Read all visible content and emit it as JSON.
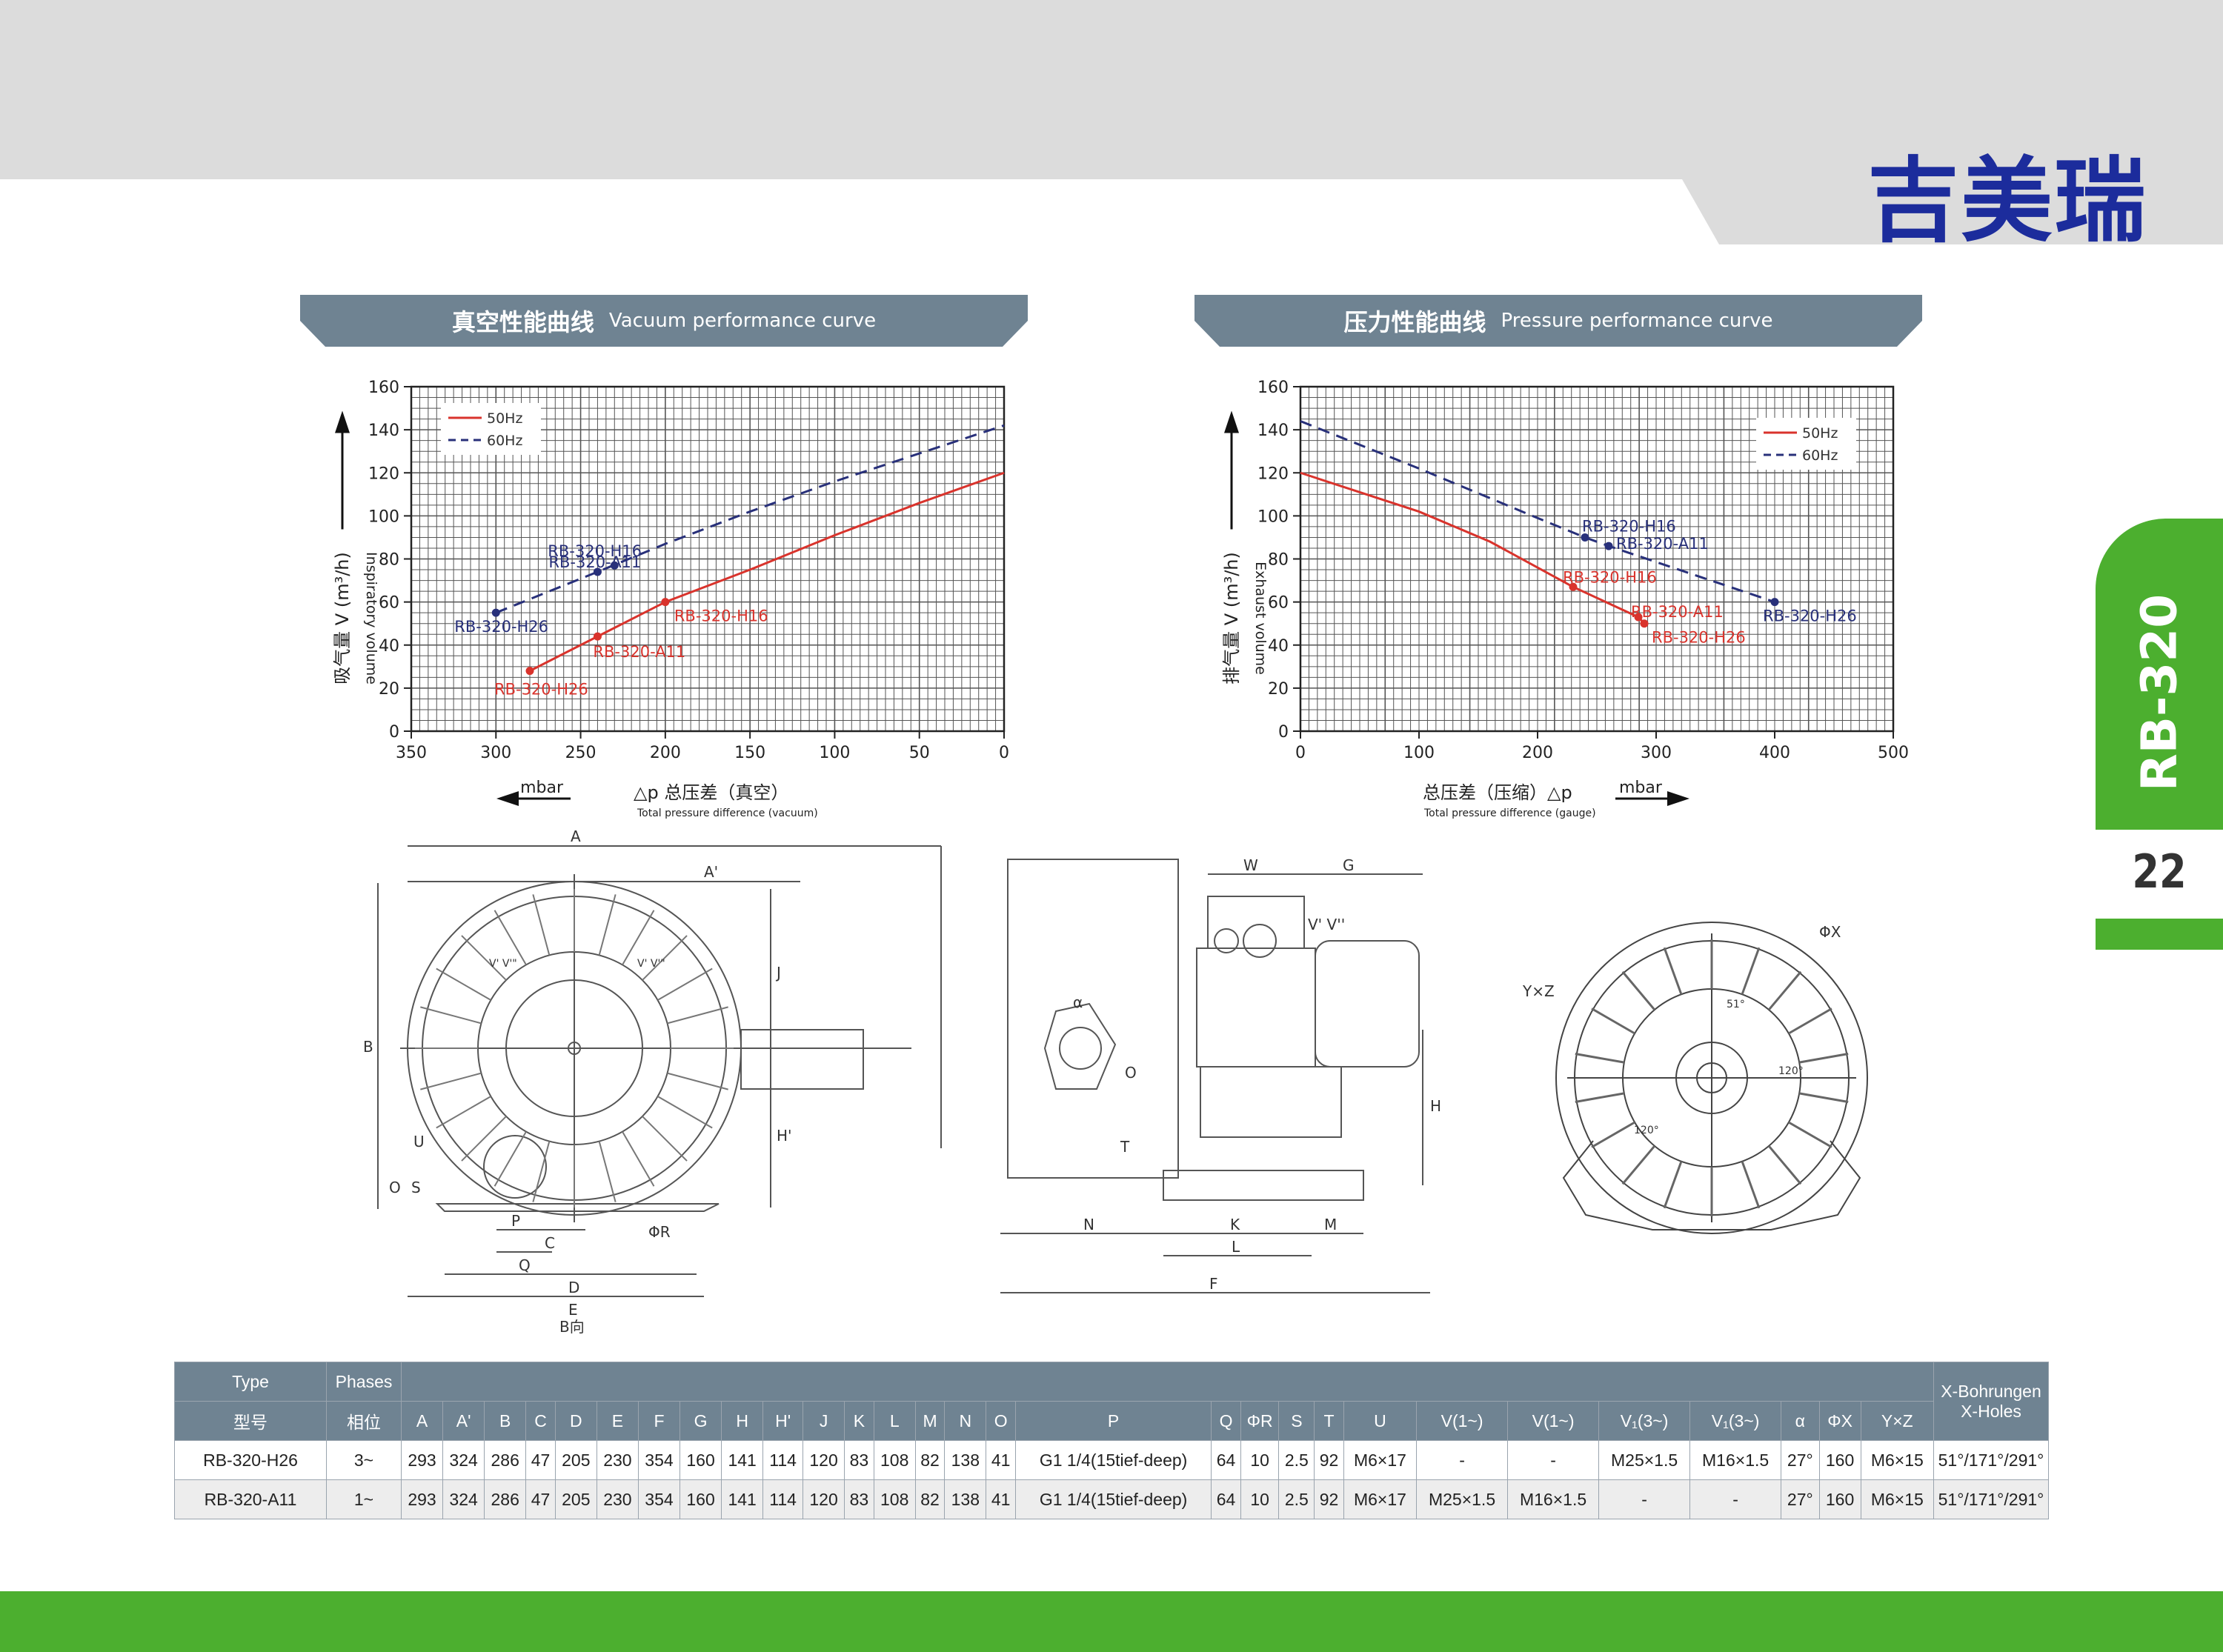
{
  "header": {
    "brand": "吉美瑞"
  },
  "side": {
    "model": "RB-320",
    "page": "22"
  },
  "vacuum": {
    "title_zh": "真空性能曲线",
    "title_en": "Vacuum performance curve",
    "ylabel_zh": "吸气量 V (m³/h)",
    "ylabel_en": "Inspiratory volume",
    "xlabel_unit": "mbar",
    "xlabel_zh": "△p  总压差（真空）",
    "xlabel_en": "Total pressure difference (vacuum)"
  },
  "pressure": {
    "title_zh": "压力性能曲线",
    "title_en": "Pressure performance curve",
    "ylabel_zh": "排气量 V (m³/h)",
    "ylabel_en": "Exhaust volume",
    "xlabel_unit": "mbar",
    "xlabel_zh": "总压差（压缩）△p",
    "xlabel_en": "Total pressure difference (gauge)"
  },
  "chart_data": [
    {
      "type": "line",
      "title": "真空性能曲线 Vacuum performance curve",
      "xlabel": "△p 总压差（真空） Total pressure difference (vacuum) mbar",
      "ylabel": "吸气量 V (m³/h) Inspiratory volume",
      "xlim": [
        350,
        0
      ],
      "ylim": [
        0,
        160
      ],
      "xticks": [
        350,
        300,
        250,
        200,
        150,
        100,
        50,
        0
      ],
      "yticks": [
        0,
        20,
        40,
        60,
        80,
        100,
        120,
        140,
        160
      ],
      "grid": true,
      "legend": "top-left",
      "series": [
        {
          "name": "50Hz",
          "color": "#d9332c",
          "dash": false,
          "x": [
            280,
            240,
            200,
            150,
            100,
            50,
            0
          ],
          "y": [
            28,
            44,
            60,
            75,
            91,
            106,
            120
          ]
        },
        {
          "name": "60Hz",
          "color": "#28307a",
          "dash": true,
          "x": [
            300,
            240,
            200,
            150,
            100,
            50,
            0
          ],
          "y": [
            55,
            74,
            87,
            102,
            116,
            129,
            142
          ]
        }
      ],
      "points": [
        {
          "label": "RB-320-H26",
          "x": 280,
          "y": 28,
          "series": "50Hz"
        },
        {
          "label": "RB-320-A11",
          "x": 240,
          "y": 44,
          "series": "50Hz"
        },
        {
          "label": "RB-320-H16",
          "x": 200,
          "y": 60,
          "series": "50Hz"
        },
        {
          "label": "RB-320-H26",
          "x": 300,
          "y": 55,
          "series": "60Hz"
        },
        {
          "label": "RB-320-A11",
          "x": 240,
          "y": 74,
          "series": "60Hz"
        },
        {
          "label": "RB-320-H16",
          "x": 230,
          "y": 77,
          "series": "60Hz"
        }
      ]
    },
    {
      "type": "line",
      "title": "压力性能曲线 Pressure performance curve",
      "xlabel": "总压差（压缩）△p Total pressure difference (gauge) mbar",
      "ylabel": "排气量 V (m³/h) Exhaust volume",
      "xlim": [
        0,
        500
      ],
      "ylim": [
        0,
        160
      ],
      "xticks": [
        0,
        100,
        200,
        300,
        400,
        500
      ],
      "yticks": [
        0,
        20,
        40,
        60,
        80,
        100,
        120,
        140,
        160
      ],
      "grid": true,
      "legend": "top-right",
      "series": [
        {
          "name": "50Hz",
          "color": "#d9332c",
          "dash": false,
          "x": [
            0,
            100,
            160,
            230,
            285,
            290
          ],
          "y": [
            120,
            102,
            88,
            67,
            53,
            50
          ]
        },
        {
          "name": "60Hz",
          "color": "#28307a",
          "dash": true,
          "x": [
            0,
            100,
            200,
            240,
            260,
            400
          ],
          "y": [
            144,
            122,
            99,
            90,
            86,
            60
          ]
        }
      ],
      "points": [
        {
          "label": "RB-320-H16",
          "x": 230,
          "y": 67,
          "series": "50Hz"
        },
        {
          "label": "RB-320-A11",
          "x": 285,
          "y": 53,
          "series": "50Hz"
        },
        {
          "label": "RB-320-H26",
          "x": 290,
          "y": 50,
          "series": "50Hz"
        },
        {
          "label": "RB-320-H16",
          "x": 240,
          "y": 90,
          "series": "60Hz"
        },
        {
          "label": "RB-320-A11",
          "x": 260,
          "y": 86,
          "series": "60Hz"
        },
        {
          "label": "RB-320-H26",
          "x": 400,
          "y": 60,
          "series": "60Hz"
        }
      ]
    }
  ],
  "drawings": {
    "front_labels": [
      "A",
      "A'",
      "B",
      "H'",
      "J",
      "U",
      "O",
      "S",
      "P",
      "C",
      "Q",
      "D",
      "E",
      "ΦR",
      "B向",
      "V' V'\"",
      "V' V'\""
    ],
    "side_labels": [
      "W",
      "G",
      "V' V''",
      "α",
      "O",
      "T",
      "H",
      "N",
      "K",
      "M",
      "L",
      "F"
    ],
    "rear_labels": [
      "ΦX",
      "Y×Z",
      "120°",
      "120°",
      "51°"
    ]
  },
  "table": {
    "header_row1": {
      "type": "Type",
      "phases": "Phases",
      "xbohr": "X-Bohrungen"
    },
    "header_row2": [
      "型号",
      "相位",
      "A",
      "A'",
      "B",
      "C",
      "D",
      "E",
      "F",
      "G",
      "H",
      "H'",
      "J",
      "K",
      "L",
      "M",
      "N",
      "O",
      "P",
      "Q",
      "ΦR",
      "S",
      "T",
      "U",
      "V(1~)",
      "V(1~)",
      "V₁(3~)",
      "V₁(3~)",
      "α",
      "ΦX",
      "Y×Z",
      "X-Holes"
    ],
    "rows": [
      [
        "RB-320-H26",
        "3~",
        "293",
        "324",
        "286",
        "47",
        "205",
        "230",
        "354",
        "160",
        "141",
        "114",
        "120",
        "83",
        "108",
        "82",
        "138",
        "41",
        "G1 1/4(15tief-deep)",
        "64",
        "10",
        "2.5",
        "92",
        "M6×17",
        "-",
        "-",
        "M25×1.5",
        "M16×1.5",
        "27°",
        "160",
        "M6×15",
        "51°/171°/291°"
      ],
      [
        "RB-320-A11",
        "1~",
        "293",
        "324",
        "286",
        "47",
        "205",
        "230",
        "354",
        "160",
        "141",
        "114",
        "120",
        "83",
        "108",
        "82",
        "138",
        "41",
        "G1 1/4(15tief-deep)",
        "64",
        "10",
        "2.5",
        "92",
        "M6×17",
        "M25×1.5",
        "M16×1.5",
        "-",
        "-",
        "27°",
        "160",
        "M6×15",
        "51°/171°/291°"
      ]
    ]
  },
  "colors": {
    "green": "#4caf2f",
    "banner": "#6f8392",
    "brand": "#1c2c9c",
    "red": "#d9332c",
    "navy": "#28307a"
  }
}
